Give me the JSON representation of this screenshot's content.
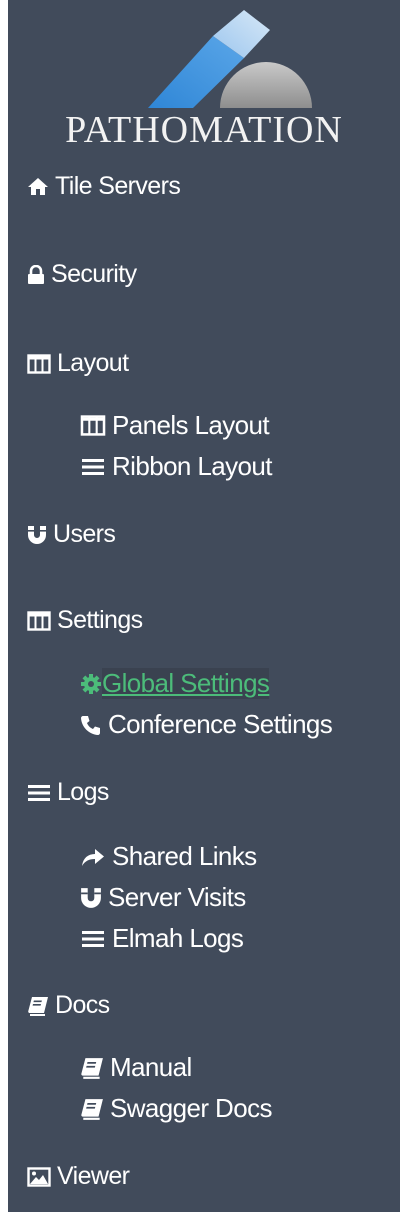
{
  "brand": {
    "name": "PATHOMATION"
  },
  "nav": {
    "tile_servers": "Tile Servers",
    "security": "Security",
    "layout": "Layout",
    "panels_layout": "Panels Layout",
    "ribbon_layout": "Ribbon Layout",
    "users": "Users",
    "settings": "Settings",
    "global_settings": " Global Settings",
    "conference_settings": "Conference Settings",
    "logs": "Logs",
    "shared_links": "Shared Links",
    "server_visits": "Server Visits",
    "elmah_logs": "Elmah Logs",
    "docs": "Docs",
    "manual": "Manual",
    "swagger_docs": "Swagger Docs",
    "viewer": "Viewer"
  },
  "icons": {
    "tile_servers": "home-icon",
    "security": "lock-icon",
    "layout": "columns-icon",
    "panels_layout": "columns-icon",
    "ribbon_layout": "bars-icon",
    "users": "magnet-icon",
    "settings": "columns-icon",
    "global_settings": "gear-icon",
    "conference_settings": "phone-icon",
    "logs": "bars-icon",
    "shared_links": "share-icon",
    "server_visits": "magnet-icon",
    "elmah_logs": "bars-icon",
    "docs": "book-icon",
    "manual": "book-icon",
    "swagger_docs": "book-icon",
    "viewer": "picture-icon"
  },
  "colors": {
    "sidebar_bg": "#414b5b",
    "active_link": "#4cbc7a",
    "text": "#ffffff"
  }
}
